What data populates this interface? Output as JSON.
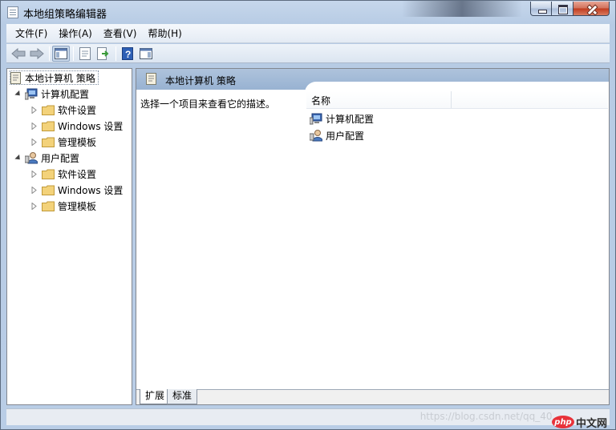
{
  "window": {
    "title": "本地组策略编辑器"
  },
  "menu": [
    "文件(F)",
    "操作(A)",
    "查看(V)",
    "帮助(H)"
  ],
  "toolbar": {
    "buttons": [
      "back-icon",
      "forward-icon",
      "show-hide-tree-icon",
      "properties-icon",
      "export-list-icon",
      "help-icon",
      "show-hide-action-pane-icon"
    ]
  },
  "tree": {
    "root": "本地计算机 策略",
    "computer": {
      "label": "计算机配置",
      "children": [
        "软件设置",
        "Windows 设置",
        "管理模板"
      ]
    },
    "user": {
      "label": "用户配置",
      "children": [
        "软件设置",
        "Windows 设置",
        "管理模板"
      ]
    }
  },
  "right": {
    "header": "本地计算机 策略",
    "description": "选择一个项目来查看它的描述。",
    "column_name": "名称",
    "items": [
      "计算机配置",
      "用户配置"
    ],
    "tabs": [
      "扩展",
      "标准"
    ]
  },
  "watermark": "https://blog.csdn.net/qq_40...",
  "logo": {
    "badge": "php",
    "text": "中文网"
  },
  "colors": {
    "title_bar": "#b9cde6",
    "header_blue": "#98b2d2",
    "folder": "#f3d27a"
  }
}
